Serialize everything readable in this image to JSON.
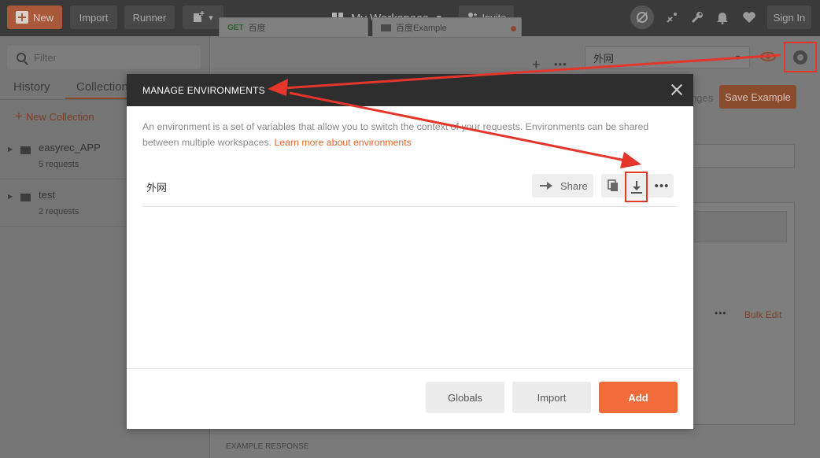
{
  "topbar": {
    "new_label": "New",
    "import_label": "Import",
    "runner_label": "Runner",
    "builder_caret": "▾",
    "workspace_label": "My Workspace",
    "invite_label": "Invite",
    "signin_label": "Sign In"
  },
  "sidebar": {
    "search_placeholder": "Filter",
    "tabs": [
      "History",
      "Collections"
    ],
    "new_collection_label": "New Collection",
    "collections": [
      {
        "name": "easyrec_APP",
        "count": "5 requests"
      },
      {
        "name": "test",
        "count": "2 requests"
      }
    ]
  },
  "main": {
    "tabs": [
      {
        "method": "GET",
        "label": "百度"
      },
      {
        "label": "百度Example"
      }
    ],
    "environment": "外网",
    "changes_label": "nges",
    "save_example_label": "Save Example",
    "bulk_edit_label": "Bulk Edit",
    "example_response_label": "EXAMPLE RESPONSE"
  },
  "modal": {
    "title": "MANAGE ENVIRONMENTS",
    "description": "An environment is a set of variables that allow you to switch the context of your requests. Environments can be shared between multiple workspaces.",
    "learn_more": "Learn more about environments",
    "environments": [
      {
        "name": "外网"
      }
    ],
    "share_label": "Share",
    "globals_label": "Globals",
    "import_label": "Import",
    "add_label": "Add"
  },
  "colors": {
    "accent": "#f26b3a",
    "link": "#e2672e",
    "annotation": "#e4362a",
    "modal_header": "#2e2e2e"
  },
  "icons": [
    "plus-icon",
    "builder-icon",
    "workspace-grid-icon",
    "invite-icon",
    "sync-off-icon",
    "satellite-icon",
    "wrench-icon",
    "bell-icon",
    "heart-icon",
    "search-icon",
    "folder-icon",
    "eye-icon",
    "gear-icon",
    "close-icon",
    "share-arrow-icon",
    "duplicate-icon",
    "download-icon",
    "more-icon"
  ]
}
